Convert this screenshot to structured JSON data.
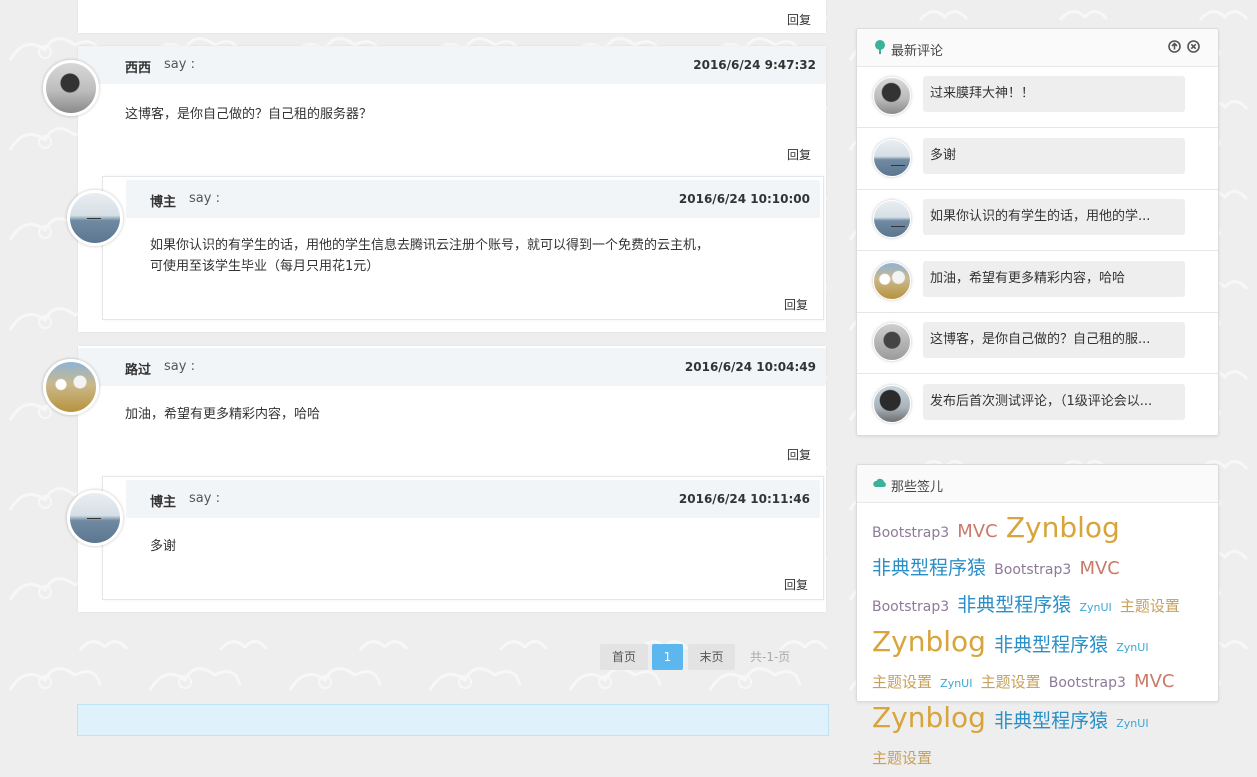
{
  "comments": {
    "reply_label": "回复",
    "say_label": "say :",
    "threads": [
      {
        "author": "西西",
        "time": "2016/6/24 9:47:32",
        "body": "这博客，是你自己做的？自己租的服务器？",
        "replies": [
          {
            "author": "博主",
            "time": "2016/6/24 10:10:00",
            "body_line1": "如果你认识的有学生的话，用他的学生信息去腾讯云注册个账号，就可以得到一个免费的云主机，",
            "body_line2": "可使用至该学生毕业（每月只用花1元）"
          }
        ]
      },
      {
        "author": "路过",
        "time": "2016/6/24 10:04:49",
        "body": "加油，希望有更多精彩内容，哈哈",
        "replies": [
          {
            "author": "博主",
            "time": "2016/6/24 10:11:46",
            "body_line1": "多谢"
          }
        ]
      }
    ]
  },
  "pagination": {
    "first": "首页",
    "current": "1",
    "last": "末页",
    "total": "共-1-页"
  },
  "latest_comments": {
    "title": "最新评论",
    "items": [
      {
        "avatar": "girl",
        "text": "过来膜拜大神！！"
      },
      {
        "avatar": "lake",
        "text": "多谢"
      },
      {
        "avatar": "lake",
        "text": "如果你认识的有学生的话，用他的学..."
      },
      {
        "avatar": "kids",
        "text": "加油，希望有更多精彩内容，哈哈"
      },
      {
        "avatar": "gray",
        "text": "这博客，是你自己做的？自己租的服..."
      },
      {
        "avatar": "girl2",
        "text": "发布后首次测试评论，（1级评论会以..."
      }
    ]
  },
  "tags": {
    "title": "那些签儿",
    "items": [
      {
        "text": "Bootstrap3",
        "style": "s"
      },
      {
        "text": "MVC",
        "style": "m"
      },
      {
        "text": "Zynblog",
        "style": "l"
      },
      {
        "text": "非典型程序猿",
        "style": "xl"
      },
      {
        "text": "Bootstrap3",
        "style": "s"
      },
      {
        "text": "MVC",
        "style": "m"
      },
      {
        "text": "Bootstrap3",
        "style": "s"
      },
      {
        "text": "非典型程序猿",
        "style": "xl"
      },
      {
        "text": "ZynUI",
        "style": "xs"
      },
      {
        "text": "主题设置",
        "style": "zt"
      },
      {
        "text": "Zynblog",
        "style": "l"
      },
      {
        "text": "非典型程序猿",
        "style": "xl"
      },
      {
        "text": "ZynUI",
        "style": "xs"
      },
      {
        "text": "主题设置",
        "style": "zt"
      },
      {
        "text": "ZynUI",
        "style": "xs"
      },
      {
        "text": "主题设置",
        "style": "zt"
      },
      {
        "text": "Bootstrap3",
        "style": "s"
      },
      {
        "text": "MVC",
        "style": "m"
      },
      {
        "text": "Zynblog",
        "style": "l"
      },
      {
        "text": "非典型程序猿",
        "style": "xl"
      },
      {
        "text": "ZynUI",
        "style": "xs"
      },
      {
        "text": "主题设置",
        "style": "zt"
      }
    ]
  },
  "colors": {
    "accent": "#5bb7ee",
    "header_bg": "#f2f5f7",
    "icon_green": "#3bb39a"
  }
}
